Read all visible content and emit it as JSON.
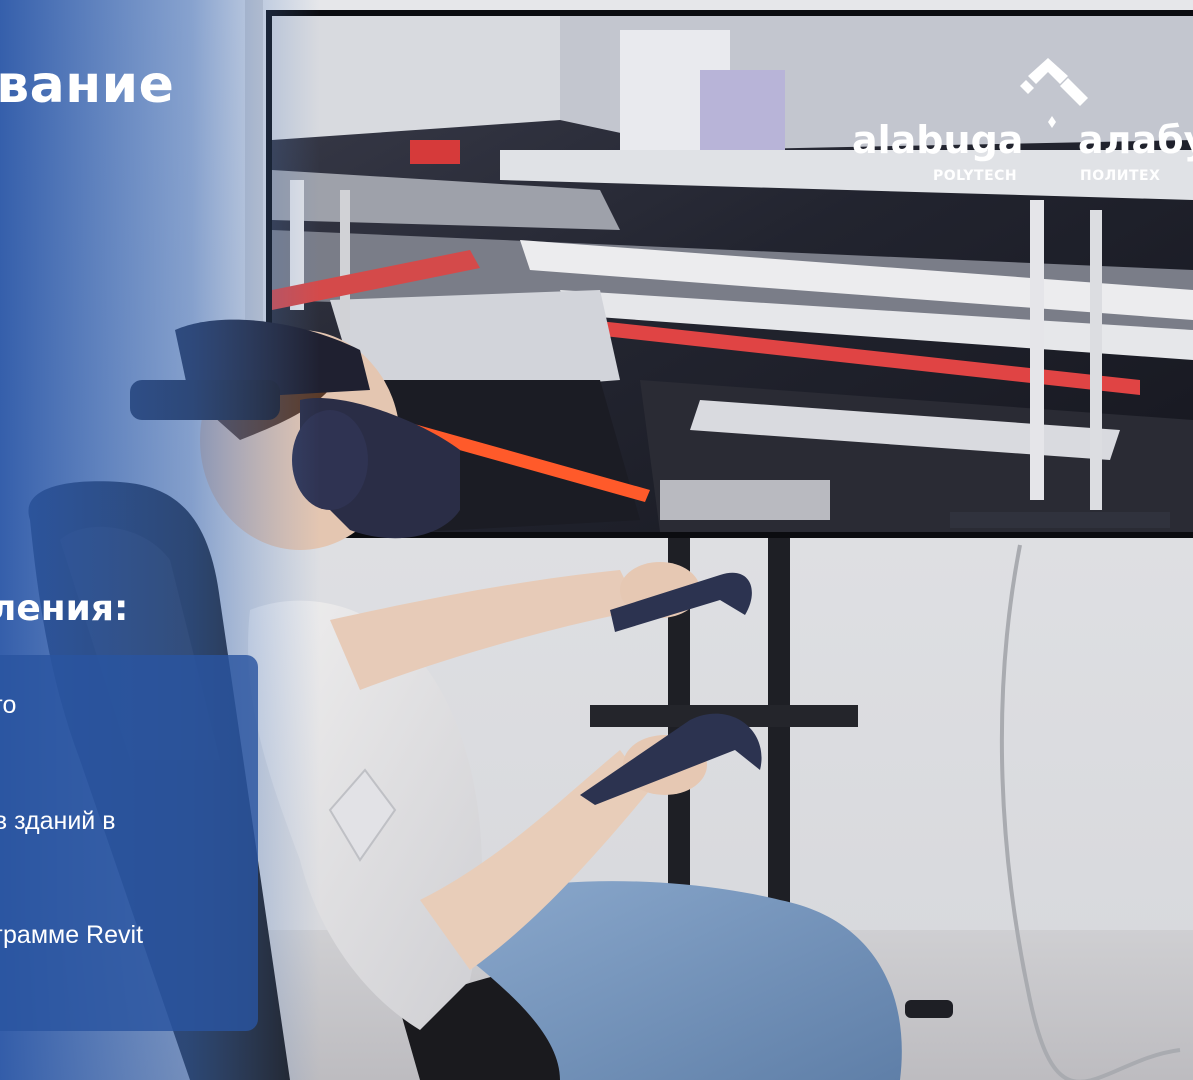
{
  "headline": "ование",
  "subheading": "ления:",
  "card": {
    "items": [
      "ого",
      "ов зданий в",
      "ограмме Revit"
    ]
  },
  "logo": {
    "latin_name": "alabuga",
    "latin_sub": "POLYTECH",
    "cyrillic_name": "алабу",
    "cyrillic_sub": "ПОЛИТЕХ"
  },
  "colors": {
    "overlay_blue": "#2a54a0",
    "text": "#ffffff",
    "wall": "#e3e4e6",
    "screen_dark": "#1a1c2a",
    "laser_orange": "#ff5a2a"
  }
}
